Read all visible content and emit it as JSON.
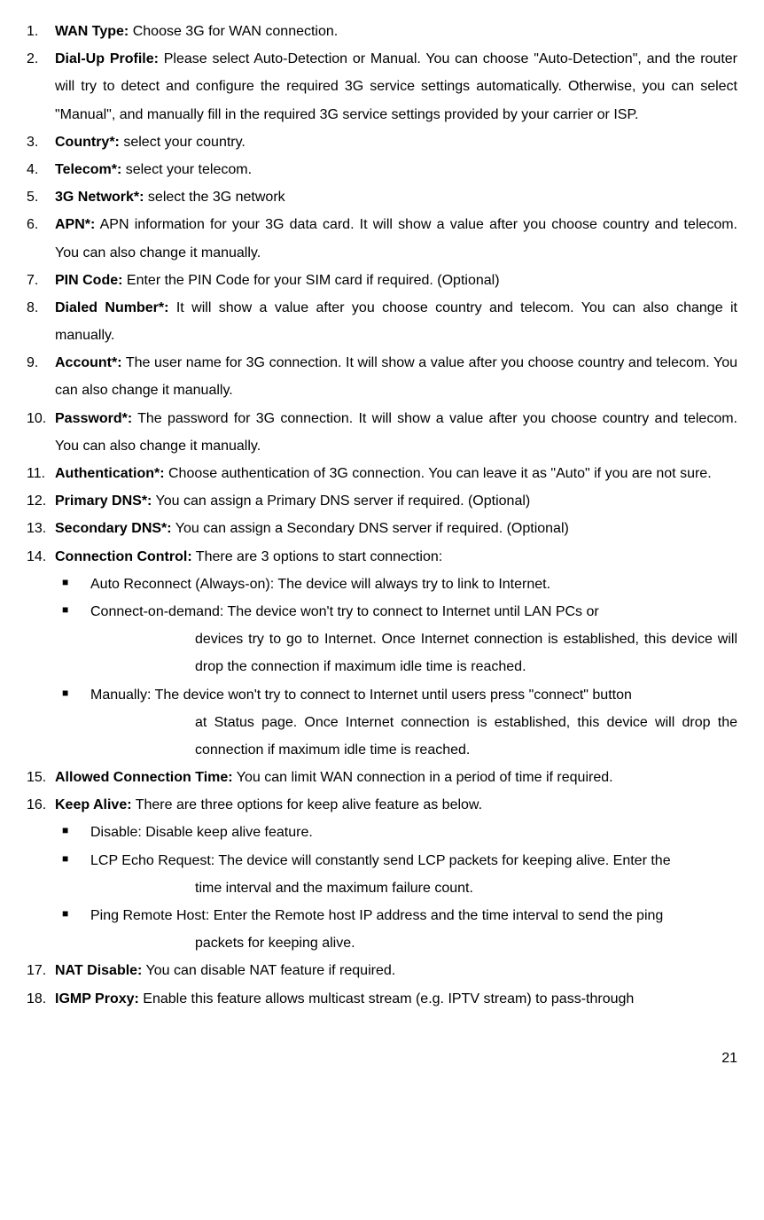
{
  "items": {
    "i1": {
      "term": "WAN Type:",
      "desc": " Choose 3G for WAN connection."
    },
    "i2": {
      "term": "Dial-Up Profile:",
      "desc": " Please select Auto-Detection or Manual. You can choose \"Auto-Detection\", and the router will try to detect and configure the required 3G service settings automatically. Otherwise, you can select \"Manual\", and manually fill in the required 3G service settings provided by your carrier or ISP."
    },
    "i3": {
      "term": "Country*:",
      "desc": " select your country."
    },
    "i4": {
      "term": "Telecom*:",
      "desc": " select your telecom."
    },
    "i5": {
      "term": "3G Network*:",
      "desc": " select the 3G network"
    },
    "i6": {
      "term": "APN*:",
      "desc": " APN information for your 3G data card. It will show a value after you choose country and telecom. You can also change it manually."
    },
    "i7": {
      "term": "PIN Code:",
      "desc": " Enter the PIN Code for your SIM card if required. (Optional)"
    },
    "i8": {
      "term": "Dialed Number*:",
      "desc": " It will show a value after you choose country and telecom. You can also change it manually."
    },
    "i9": {
      "term": "Account*:",
      "desc": " The user name for 3G connection. It will show a value after you choose country and telecom. You can also change it manually."
    },
    "i10": {
      "term": "Password*:",
      "desc": " The password for 3G connection. It will show a value after you choose country and telecom. You can also change it manually."
    },
    "i11": {
      "term": "Authentication*:",
      "desc": " Choose authentication of 3G connection. You can leave it as \"Auto\" if you are not sure."
    },
    "i12": {
      "term": "Primary DNS*:",
      "desc": " You can assign a Primary DNS server if required. (Optional)"
    },
    "i13": {
      "term": "Secondary DNS*:",
      "desc": " You can assign a Secondary DNS server if required. (Optional)"
    },
    "i14": {
      "term": "Connection Control:",
      "desc": " There are 3 options to start connection:",
      "subs": {
        "s1": {
          "text": "Auto Reconnect (Always-on): The device will always try to link to Internet."
        },
        "s2": {
          "text": "Connect-on-demand: The device won't try to connect to Internet until LAN PCs or",
          "cont": "devices try to go to Internet. Once Internet connection is established, this device will drop the connection if maximum idle time is reached."
        },
        "s3": {
          "text": "Manually: The device won't try to connect to Internet until users press \"connect\" button",
          "cont": "at Status page. Once Internet connection is established, this device will drop the connection if maximum idle time is reached."
        }
      }
    },
    "i15": {
      "term": "Allowed Connection Time:",
      "desc": " You can limit WAN connection in a period of time if required."
    },
    "i16": {
      "term": "Keep Alive:",
      "desc": " There are three options for keep alive feature as below.",
      "subs": {
        "s1": {
          "text": "Disable: Disable keep alive feature."
        },
        "s2": {
          "text": "LCP Echo Request: The device will constantly send LCP packets for keeping alive. Enter the",
          "cont": "time interval and the maximum failure count."
        },
        "s3": {
          "text": "Ping Remote Host: Enter the Remote host IP address and the time interval to send the ping",
          "cont": "packets for keeping alive."
        }
      }
    },
    "i17": {
      "term": " NAT Disable:",
      "desc": " You can disable NAT feature if required."
    },
    "i18": {
      "term": "IGMP Proxy:",
      "desc": " Enable this feature allows multicast stream (e.g. IPTV stream) to pass-through"
    }
  },
  "page_number": "21"
}
